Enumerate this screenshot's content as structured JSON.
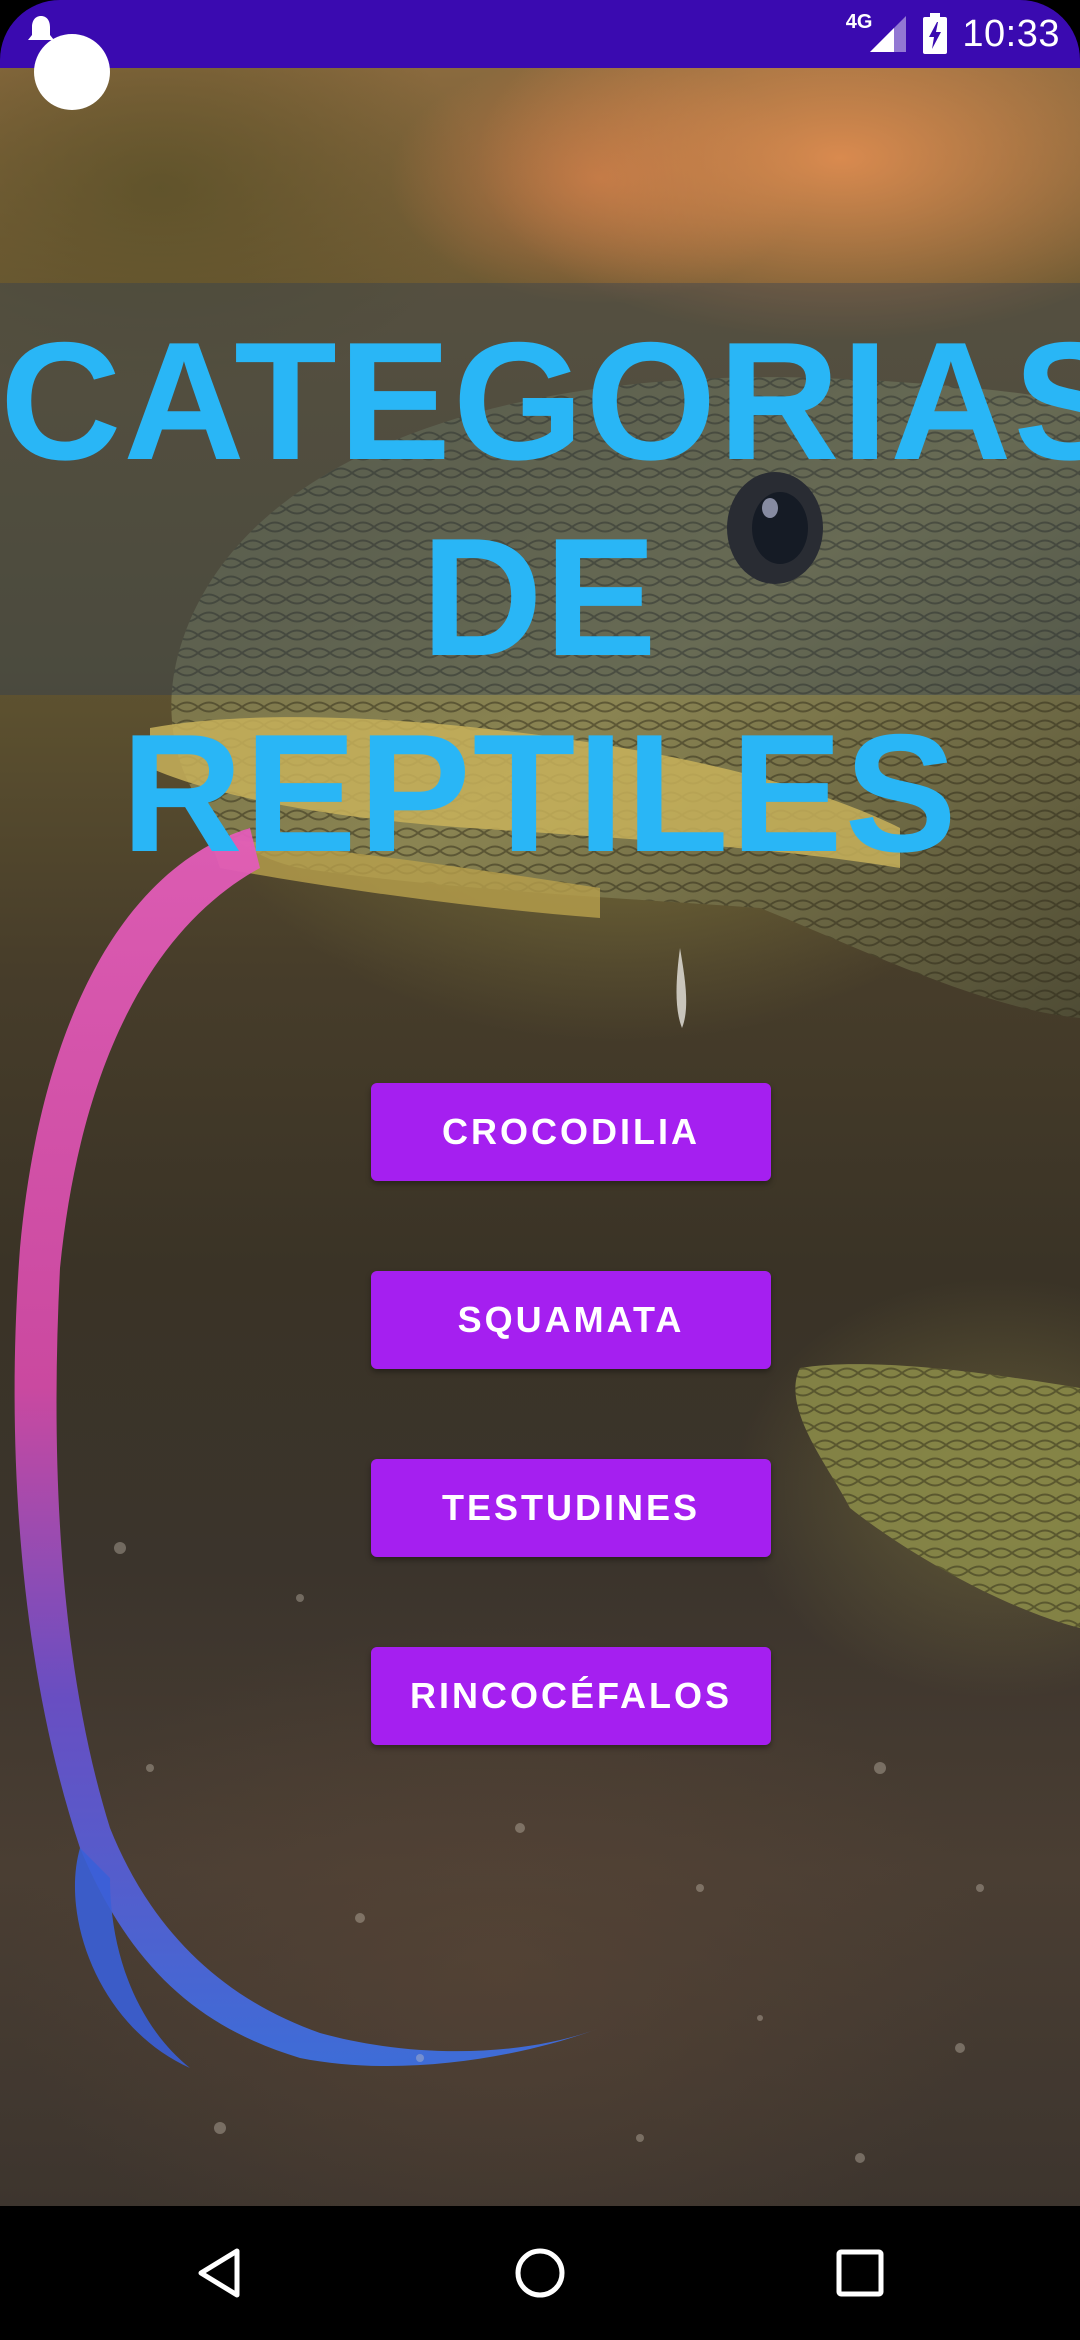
{
  "status_bar": {
    "network_label": "4G",
    "time": "10:33",
    "signal_icon": "cell-signal-icon",
    "battery_icon": "battery-charging-icon",
    "notification_icon": "notification-icon",
    "background_color": "#3a0ab0"
  },
  "screen": {
    "title_line1": "CATEGORIAS",
    "title_line2": "DE REPTILES",
    "title_color": "#29b6f6",
    "background_image": "monitor lizard with forked tongue"
  },
  "buttons": [
    {
      "label": "CROCODILIA"
    },
    {
      "label": "SQUAMATA"
    },
    {
      "label": "TESTUDINES"
    },
    {
      "label": "RINCOCÉFALOS"
    }
  ],
  "button_color": "#a51ff0",
  "nav_bar": {
    "back_icon": "back-triangle-icon",
    "home_icon": "home-circle-icon",
    "recents_icon": "recents-square-icon"
  }
}
